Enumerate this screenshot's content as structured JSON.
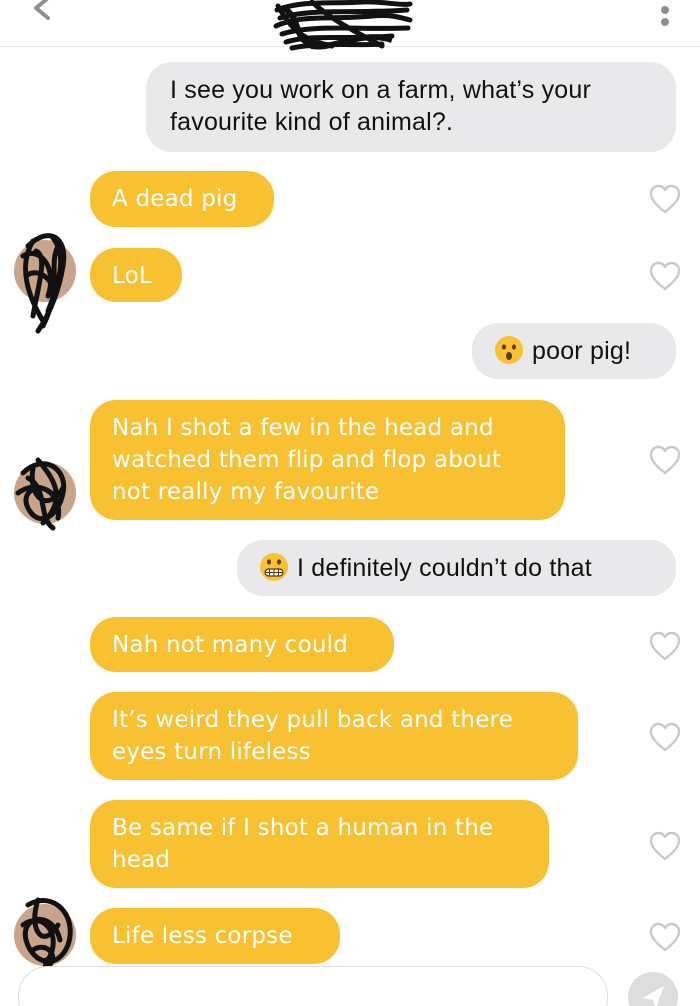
{
  "header": {
    "back_icon": "chevron-left-icon",
    "menu_icon": "vertical-ellipsis-icon"
  },
  "colors": {
    "incoming_bubble": "#f7c132",
    "outgoing_bubble": "#e9e9eb",
    "heart_outline": "#c9c9c9"
  },
  "messages": [
    {
      "direction": "outgoing",
      "lines": [
        "I see you work on a farm, what’s your",
        "favourite kind of animal?."
      ]
    },
    {
      "direction": "incoming",
      "lines": [
        "A dead pig"
      ]
    },
    {
      "direction": "incoming",
      "lines": [
        "LoL"
      ]
    },
    {
      "direction": "outgoing",
      "emoji": "astonished-face-icon",
      "lines": [
        "poor pig!"
      ]
    },
    {
      "direction": "incoming",
      "lines": [
        "Nah I shot a few in the head and",
        "watched them flip and flop about",
        "not really my favourite"
      ]
    },
    {
      "direction": "outgoing",
      "emoji": "grimacing-face-icon",
      "lines": [
        "I definitely couldn’t do that"
      ]
    },
    {
      "direction": "incoming",
      "lines": [
        "Nah not many could"
      ]
    },
    {
      "direction": "incoming",
      "lines": [
        "It’s weird they pull back and there",
        "eyes turn lifeless"
      ]
    },
    {
      "direction": "incoming",
      "lines": [
        "Be same if I shot a human in the",
        "head"
      ]
    },
    {
      "direction": "incoming",
      "lines": [
        "Life less corpse"
      ]
    }
  ],
  "composer": {
    "send_icon": "send-arrow-icon"
  }
}
